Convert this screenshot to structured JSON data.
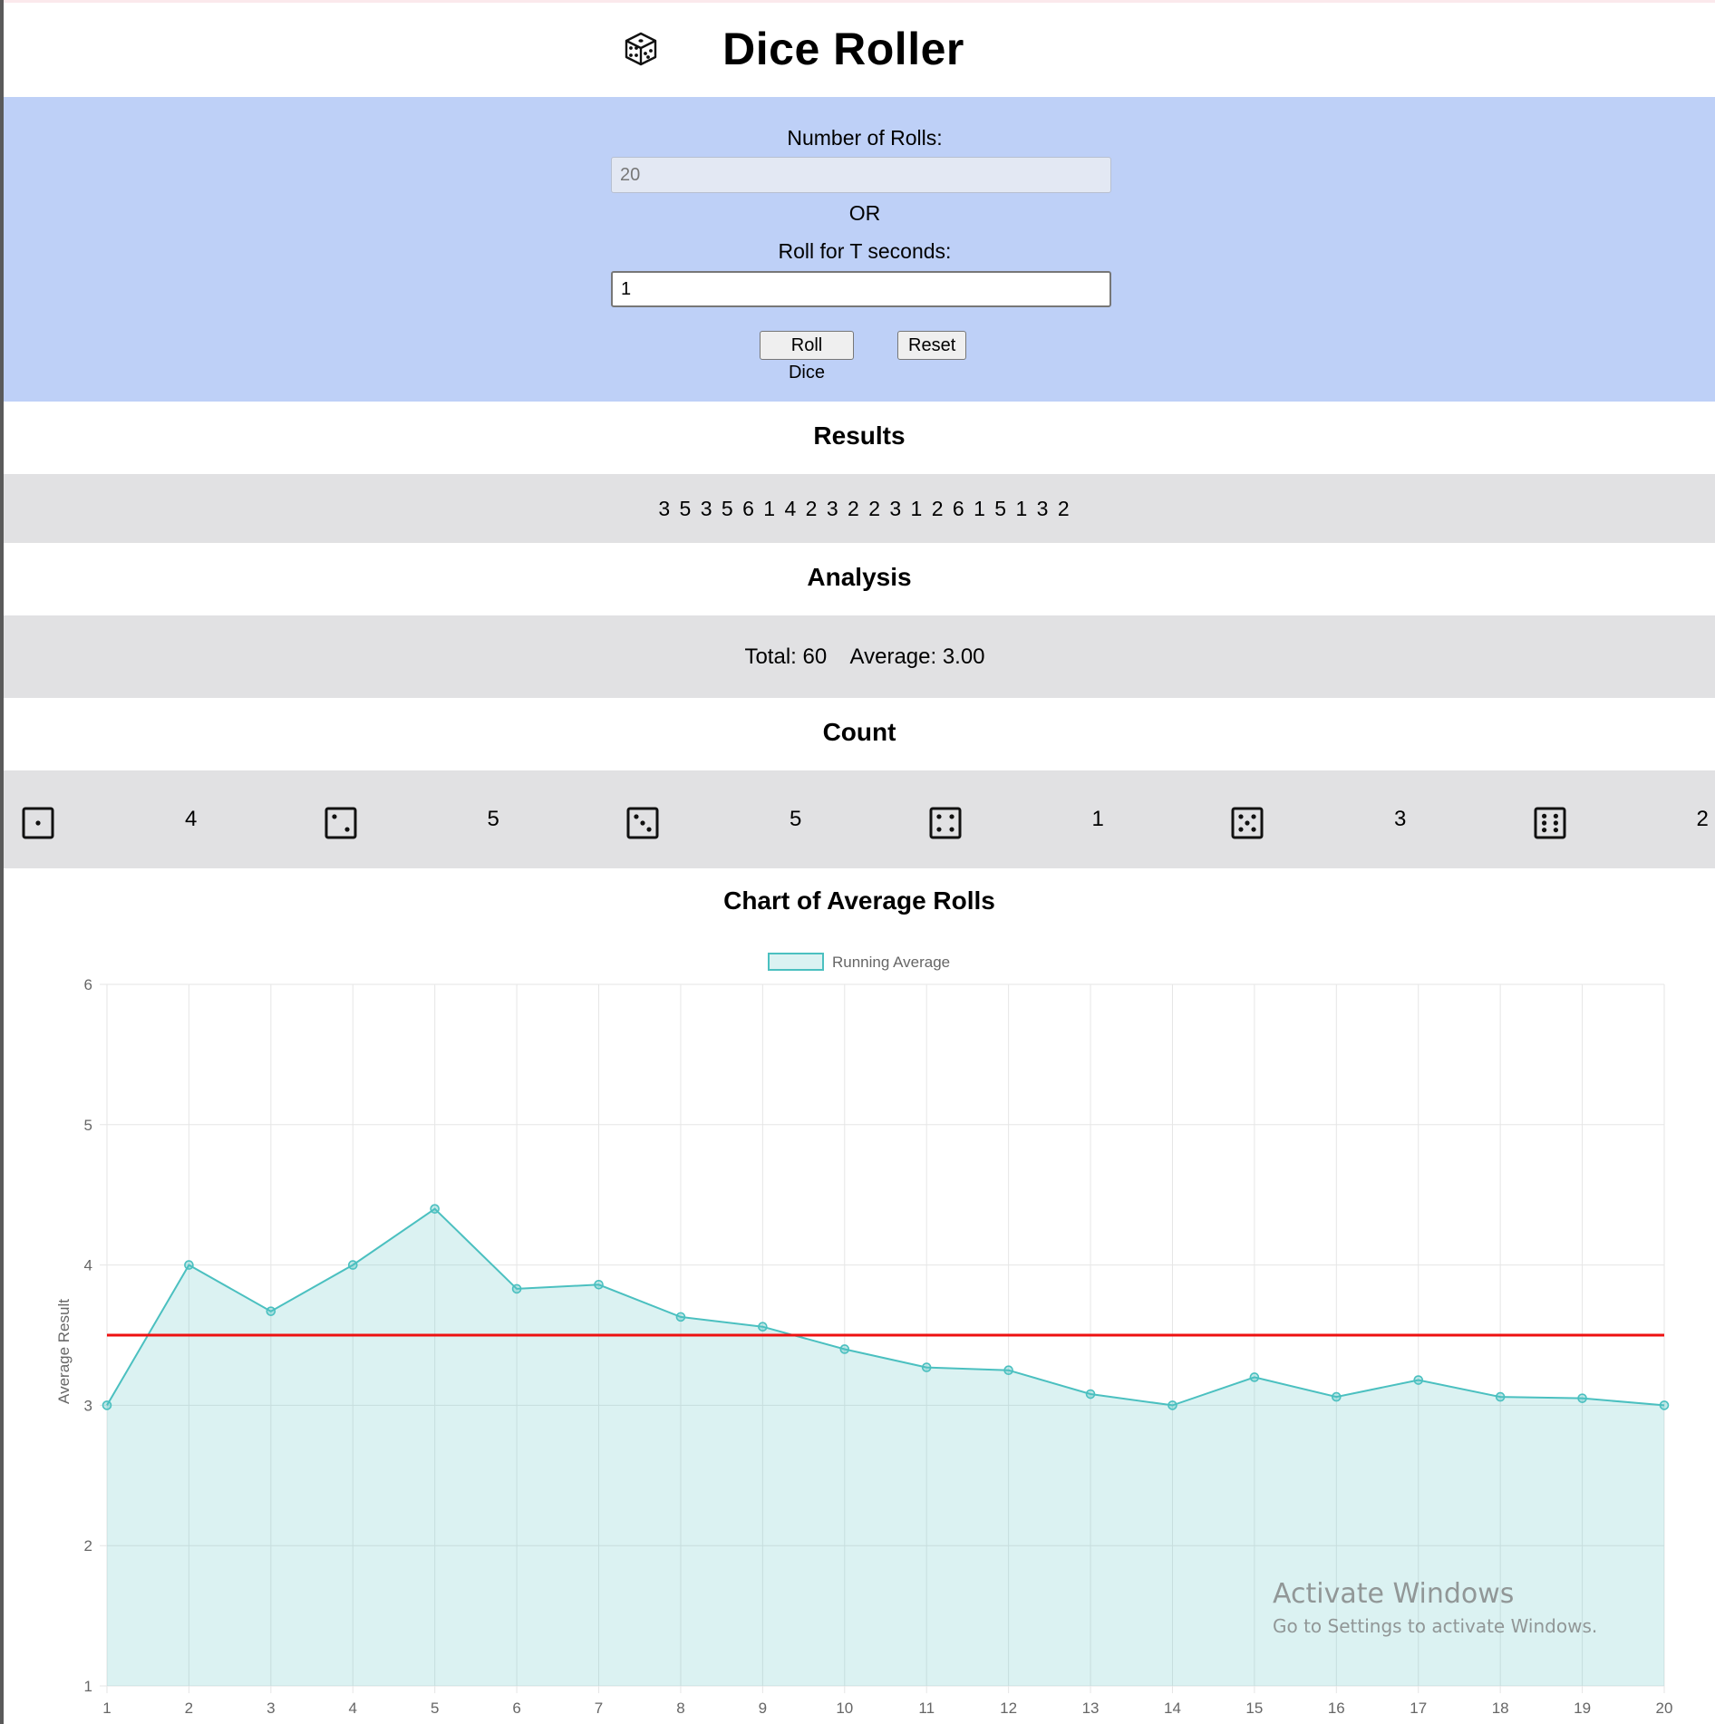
{
  "app": {
    "title": "Dice Roller",
    "logo_icon": "dice-icon"
  },
  "controls": {
    "rolls_label": "Number of Rolls:",
    "rolls_value": "20",
    "or_label": "OR",
    "seconds_label": "Roll for T seconds:",
    "seconds_value": "1",
    "roll_button": "Roll Dice",
    "reset_button": "Reset"
  },
  "results": {
    "heading": "Results",
    "values": "3 5 3 5 6 1 4 2 3 2 2 3 1 2 6 1 5 1 3 2"
  },
  "analysis": {
    "heading": "Analysis",
    "text": "Total: 60    Average: 3.00"
  },
  "count": {
    "heading": "Count",
    "items": [
      {
        "face": 1,
        "icon": "die-face-1-icon",
        "count": "4"
      },
      {
        "face": 2,
        "icon": "die-face-2-icon",
        "count": "5"
      },
      {
        "face": 3,
        "icon": "die-face-3-icon",
        "count": "5"
      },
      {
        "face": 4,
        "icon": "die-face-4-icon",
        "count": "1"
      },
      {
        "face": 5,
        "icon": "die-face-5-icon",
        "count": "3"
      },
      {
        "face": 6,
        "icon": "die-face-6-icon",
        "count": "2"
      }
    ]
  },
  "chart": {
    "heading": "Chart of Average Rolls"
  },
  "chart_data": {
    "type": "line",
    "title": "",
    "xlabel": "",
    "ylabel": "Average Result",
    "x": [
      1,
      2,
      3,
      4,
      5,
      6,
      7,
      8,
      9,
      10,
      11,
      12,
      13,
      14,
      15,
      16,
      17,
      18,
      19,
      20
    ],
    "series": [
      {
        "name": "Running Average",
        "values": [
          3.0,
          4.0,
          3.67,
          4.0,
          4.4,
          3.83,
          3.86,
          3.63,
          3.56,
          3.4,
          3.27,
          3.25,
          3.08,
          3.0,
          3.2,
          3.06,
          3.18,
          3.06,
          3.05,
          3.0
        ],
        "color": "#4bc0c0",
        "fill": "rgba(75,192,192,0.2)"
      }
    ],
    "reference_line": {
      "y": 3.5,
      "color": "#ee1111"
    },
    "ylim": [
      1,
      6
    ],
    "yticks": [
      1,
      2,
      3,
      4,
      5,
      6
    ],
    "grid": true,
    "legend": "top-center"
  },
  "watermark": {
    "line1": "Activate Windows",
    "line2": "Go to Settings to activate Windows."
  },
  "colors": {
    "control_panel_bg": "#bed0f7",
    "band_bg": "#e1e1e3",
    "accent": "#4bc0c0"
  }
}
